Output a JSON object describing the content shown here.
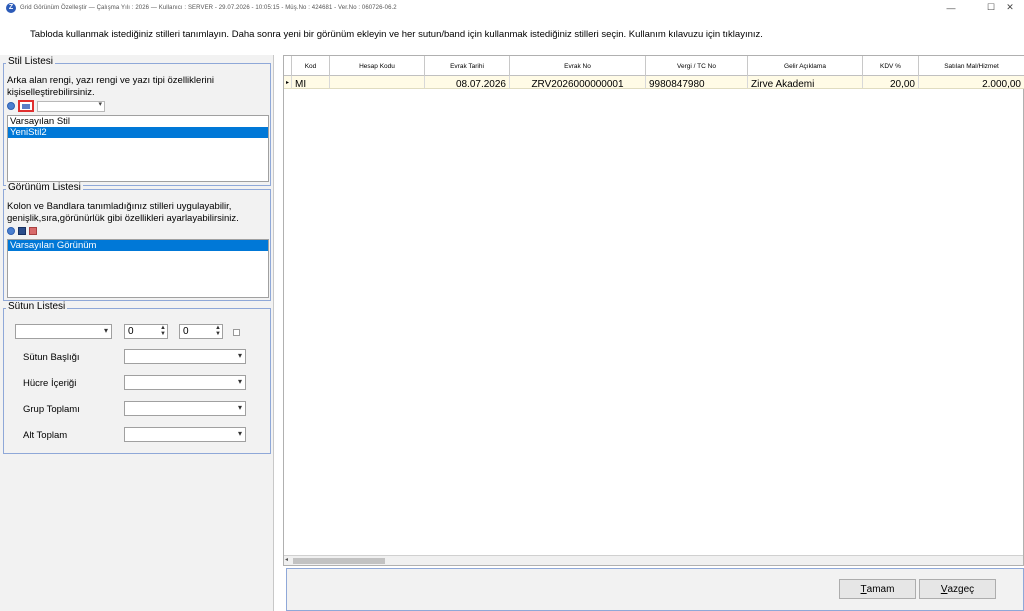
{
  "window": {
    "app_icon_letter": "Z",
    "title": "Grid Görünüm Özelleştir  —  Çalışma Yılı : 2026  —  Kullanıcı : SERVER - 29.07.2026 - 10:05:15 - Müş.No : 424681 - Ver.No : 060726-06.2",
    "minimize": "—",
    "maximize": "☐",
    "close": "✕"
  },
  "instruction": "Tabloda kullanmak istediğiniz stilleri tanımlayın. Daha sonra  yeni bir görünüm ekleyin ve her sutun/band için kullanmak istediğiniz stilleri seçin. Kullanım kılavuzu için tıklayınız.",
  "style_list": {
    "title": "Stil Listesi",
    "description_line1": "Arka alan rengi, yazı rengi ve yazı tipi özelliklerini",
    "description_line2": "kişiselleştirebilirsiniz.",
    "items": [
      "Varsayılan Stil",
      "YeniStil2"
    ],
    "selected_index": 1
  },
  "view_list": {
    "title": "Görünüm Listesi",
    "description_line1": "Kolon ve Bandlara tanımladığınız stilleri uygulayabilir,",
    "description_line2": "genişlik,sıra,görünürlük gibi özellikleri ayarlayabilirsiniz.",
    "items": [
      "Varsayılan Görünüm"
    ],
    "selected_index": 0
  },
  "column_list": {
    "title": "Sütun Listesi",
    "spin1_value": "0",
    "spin2_value": "0",
    "labels": {
      "column_header": "Sütun Başlığı",
      "cell_content": "Hücre İçeriği",
      "group_total": "Grup Toplamı",
      "sub_total": "Alt Toplam"
    }
  },
  "grid": {
    "columns": [
      "Kod",
      "Hesap Kodu",
      "Evrak Tarihi",
      "Evrak No",
      "Vergi / TC No",
      "Gelir Açıklama",
      "KDV %",
      "Satılan Mal/Hizmet"
    ],
    "row": [
      "MI",
      "",
      "08.07.2026",
      "ZRV2026000000001",
      "9980847980",
      "Zirve Akademi",
      "20,00",
      "2.000,00"
    ],
    "row_indicator": "▸"
  },
  "buttons": {
    "ok_prefix": "",
    "ok_mnemonic": "T",
    "ok_rest": "amam",
    "cancel_prefix": "",
    "cancel_mnemonic": "V",
    "cancel_rest": "azgeç"
  }
}
